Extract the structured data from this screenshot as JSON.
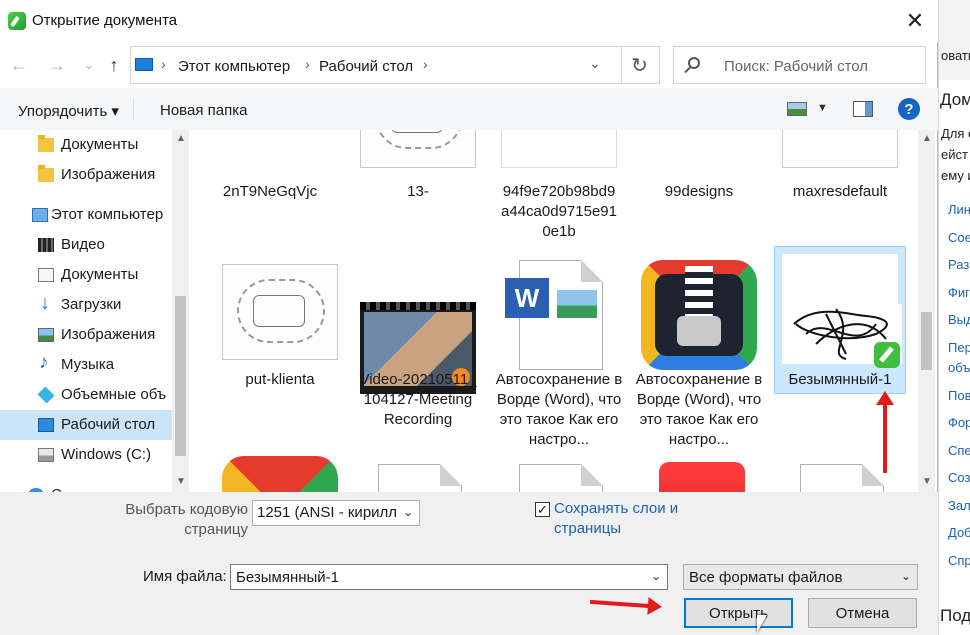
{
  "dialog": {
    "title": "Открытие документа",
    "close_glyph": "✕"
  },
  "nav": {
    "back_glyph": "←",
    "forward_glyph": "→",
    "recent_glyph": "⌄",
    "up_glyph": "↑",
    "breadcrumbs": [
      "Этот компьютер",
      "Рабочий стол"
    ],
    "crumb_sep": "›",
    "refresh_glyph": "↻",
    "dropdown_glyph": "⌄",
    "search_placeholder": "Поиск: Рабочий стол"
  },
  "toolbar": {
    "organize_label": "Упорядочить ▾",
    "new_folder_label": "Новая папка",
    "help_glyph": "?"
  },
  "sidebar": {
    "items": [
      {
        "label": "Документы",
        "icon": "folder-icon"
      },
      {
        "label": "Изображения",
        "icon": "folder-icon"
      },
      {
        "label": "Этот компьютер",
        "icon": "computer-icon"
      },
      {
        "label": "Видео",
        "icon": "video-icon"
      },
      {
        "label": "Документы",
        "icon": "documents-icon"
      },
      {
        "label": "Загрузки",
        "icon": "downloads-icon"
      },
      {
        "label": "Изображения",
        "icon": "images-icon"
      },
      {
        "label": "Музыка",
        "icon": "music-icon"
      },
      {
        "label": "Объемные объ",
        "icon": "3d-objects-icon"
      },
      {
        "label": "Рабочий стол",
        "icon": "desktop-icon"
      },
      {
        "label": "Windows (C:)",
        "icon": "drive-icon"
      },
      {
        "label": "С",
        "icon": "network-icon"
      }
    ]
  },
  "files": {
    "row1": [
      {
        "name": "2nT9NeGqVjc"
      },
      {
        "name": "13-"
      },
      {
        "name": "94f9e720b98bd9 a44ca0d9715e91 0e1b"
      },
      {
        "name": "99designs"
      },
      {
        "name": "maxresdefault"
      }
    ],
    "row2": [
      {
        "name": "put-klienta"
      },
      {
        "name": "Video-20210511_ 104127-Meeting Recording"
      },
      {
        "name": "Автосохранение в Ворде (Word), что это такое Как его настро..."
      },
      {
        "name": "Автосохранение в Ворде (Word), что это такое Как его настро..."
      },
      {
        "name": "Безымянный-1"
      }
    ],
    "word_badge": "W"
  },
  "bottom": {
    "codepage_label": "Выбрать кодовую страницу",
    "codepage_value": "1251  (ANSI - кирилл",
    "keep_layers_label": "Сохранять слои и страницы",
    "keep_layers_checked": "✓",
    "filename_label": "Имя файла:",
    "filename_value": "Безымянный-1",
    "filetype_value": "Все форматы файлов",
    "open_label": "Открыть",
    "cancel_label": "Отмена",
    "caret_glyph": "⌄"
  },
  "background_app": {
    "top_text": "овать",
    "heading": "Дом",
    "text_lines": [
      "Для о",
      "ейст",
      "ему и"
    ],
    "links": [
      "Лин",
      "Сое",
      "Раз",
      "Фиг",
      "Выд",
      "Пер",
      "объ",
      "Пов",
      "Фор",
      "Спе",
      "Соз",
      "Зал",
      "Доб",
      "Спр"
    ],
    "bottom_heading": "Подр"
  },
  "colors": {
    "selection": "#cce8ff",
    "nav_selected": "#cce4f7",
    "accent_blue": "#0078d7",
    "link_blue": "#1a64b0",
    "annotation_red": "#e21b1b"
  }
}
